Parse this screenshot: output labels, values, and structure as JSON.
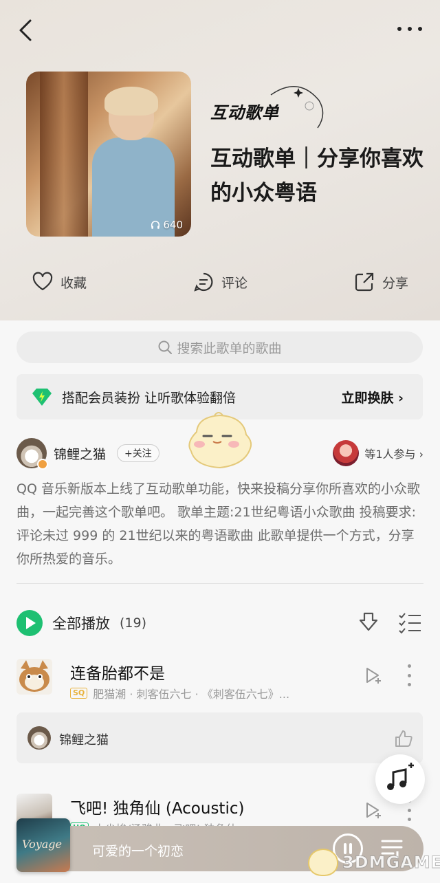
{
  "hero": {
    "badge": "互动歌单",
    "title": "互动歌单｜分享你喜欢的小众粤语",
    "play_count": "640"
  },
  "actions": {
    "favorite": "收藏",
    "comment": "评论",
    "share": "分享"
  },
  "search": {
    "placeholder": "搜索此歌单的歌曲"
  },
  "vip_banner": {
    "text": "搭配会员装扮  让听歌体验翻倍",
    "cta": "立即换肤 ›"
  },
  "creator": {
    "name": "锦鲤之猫",
    "follow": "+关注",
    "participants": "等1人参与 ›"
  },
  "description": "QQ 音乐新版本上线了互动歌单功能，快来投稿分享你所喜欢的小众歌曲，一起完善这个歌单吧。 歌单主题:21世纪粤语小众歌曲 投稿要求:评论未过 999 的 21世纪以来的粤语歌曲 此歌单提供一个方式，分享你所热爱的音乐。",
  "playall": {
    "label": "全部播放",
    "count": "(19)"
  },
  "songs": [
    {
      "title": "连备胎都不是",
      "quality": "SQ",
      "meta": "肥猫潮 · 刺客伍六七 · 《刺客伍六七》..."
    },
    {
      "title": "飞吧! 独角仙 (Acoustic)",
      "quality": "HQ",
      "meta": "小尘埃/汤骏业 · 飞吧! 独角仙"
    }
  ],
  "contributor": {
    "name": "锦鲤之猫"
  },
  "player": {
    "now_playing": "可爱的一个初恋",
    "cover_text": "Voyage"
  },
  "watermark": {
    "text": "3DMGAME"
  },
  "colors": {
    "accent_green": "#1ec072",
    "sq_gold": "#e8b23a"
  }
}
